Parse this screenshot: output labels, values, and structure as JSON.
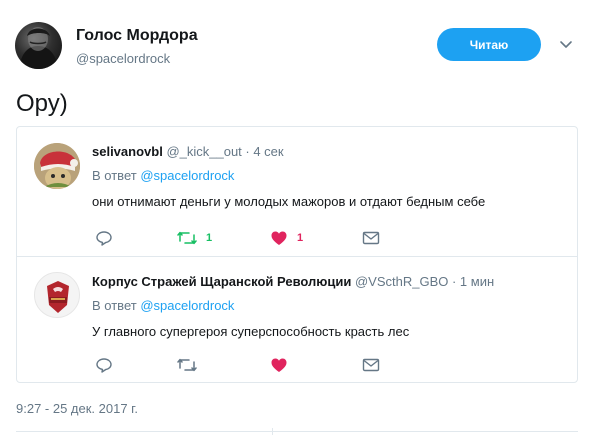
{
  "author": {
    "name": "Голос Мордора",
    "handle": "@spacelordrock"
  },
  "follow_button": {
    "label": "Читаю"
  },
  "tweet": {
    "text": "Ору)",
    "timestamp": "9:27 - 25 дек. 2017 г."
  },
  "replies": [
    {
      "name": "selivanovbl",
      "meta": "@_kick__out · 4 сек",
      "reply_to_prefix": "В ответ ",
      "reply_to_mention": "@spacelordrock",
      "text": "они отнимают деньги у молодых мажоров и отдают бедным себе",
      "retweets": "1",
      "likes": "1"
    },
    {
      "name": "Корпус Стражей Щаранской Революции",
      "meta": "@VScthR_GBO · 1 мин",
      "reply_to_prefix": "В ответ ",
      "reply_to_mention": "@spacelordrock",
      "text": "У главного супергероя суперспособность красть лес",
      "retweets": "",
      "likes": ""
    }
  ],
  "colors": {
    "accent": "#1da1f2",
    "retweet": "#17bf63",
    "like": "#e0245e",
    "secondary_text": "#657786"
  }
}
